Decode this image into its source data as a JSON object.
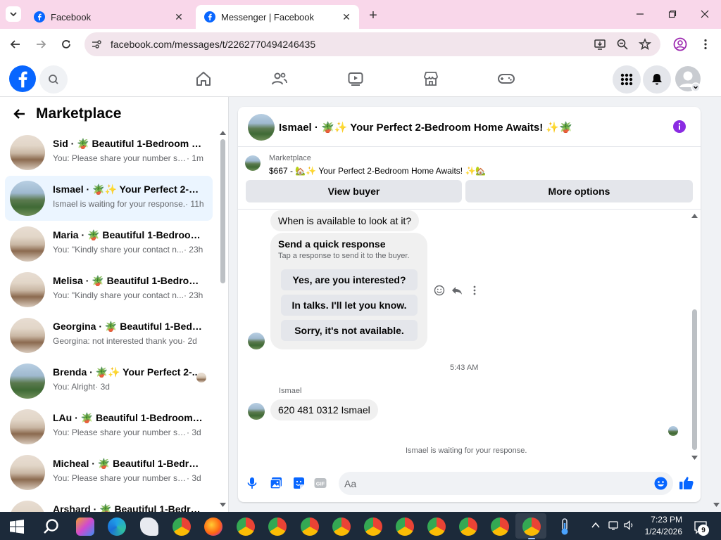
{
  "browser": {
    "tabs": [
      {
        "title": "Facebook",
        "active": false
      },
      {
        "title": "Messenger | Facebook",
        "active": true
      }
    ],
    "url": "facebook.com/messages/t/2262770494246435"
  },
  "sidebar": {
    "title": "Marketplace",
    "conversations": [
      {
        "name": "Sid · 🪴 Beautiful 1-Bedroom Ho...",
        "preview": "You: Please share your number so ...",
        "time": " · 1m",
        "avatar": "kitchen",
        "active": false
      },
      {
        "name": "Ismael · 🪴✨ Your Perfect 2-Be...",
        "preview": "Ismael is waiting for your response.",
        "time": " · 11h",
        "avatar": "house",
        "active": true
      },
      {
        "name": "Maria · 🪴 Beautiful 1-Bedroom ...",
        "preview": "You: \"Kindly share your contact n...",
        "time": " · 23h",
        "avatar": "kitchen",
        "active": false
      },
      {
        "name": "Melisa · 🪴 Beautiful 1-Bedroom...",
        "preview": "You: \"Kindly share your contact n...",
        "time": " · 23h",
        "avatar": "kitchen",
        "active": false
      },
      {
        "name": "Georgina · 🪴 Beautiful 1-Bedro...",
        "preview": "Georgina: not interested thank you",
        "time": " · 2d",
        "avatar": "kitchen",
        "active": false
      },
      {
        "name": "Brenda · 🪴✨ Your Perfect 2-...",
        "preview": "You: Alright",
        "time": " · 3d",
        "avatar": "house",
        "active": false
      },
      {
        "name": "LAu · 🪴 Beautiful 1-Bedroom H...",
        "preview": "You: Please share your number so ...",
        "time": " · 3d",
        "avatar": "kitchen",
        "active": false
      },
      {
        "name": "Micheal · 🪴 Beautiful 1-Bedroo...",
        "preview": "You: Please share your number so ...",
        "time": " · 3d",
        "avatar": "kitchen",
        "active": false
      },
      {
        "name": "Arshard · 🪴 Beautiful 1-Bedroo...",
        "preview": "",
        "time": "",
        "avatar": "kitchen",
        "active": false
      }
    ]
  },
  "chat": {
    "header_title": "Ismael · 🪴✨ Your Perfect 2-Bedroom Home Awaits! ✨🪴",
    "listing_label": "Marketplace",
    "listing_title": "$667 - 🏡✨ Your Perfect 2-Bedroom Home Awaits! ✨🏡",
    "view_buyer": "View buyer",
    "more_options": "More options",
    "message1": "When is available to look at it?",
    "quick_title": "Send a quick response",
    "quick_sub": "Tap a response to send it to the buyer.",
    "quick_options": [
      "Yes, are you interested?",
      "In talks. I'll let you know.",
      "Sorry, it's not available."
    ],
    "timestamp": "5:43 AM",
    "sender": "Ismael",
    "message2": "620 481 0312 Ismael",
    "waiting": "Ismael is waiting for your response.",
    "composer_placeholder": "Aa"
  },
  "taskbar": {
    "time": "7:23 PM",
    "date": "1/24/2026",
    "notifications": "9"
  },
  "colors": {
    "facebook_blue": "#0866ff",
    "messenger_purple": "#8a2be2",
    "tab_bar": "#f9d7ea"
  }
}
